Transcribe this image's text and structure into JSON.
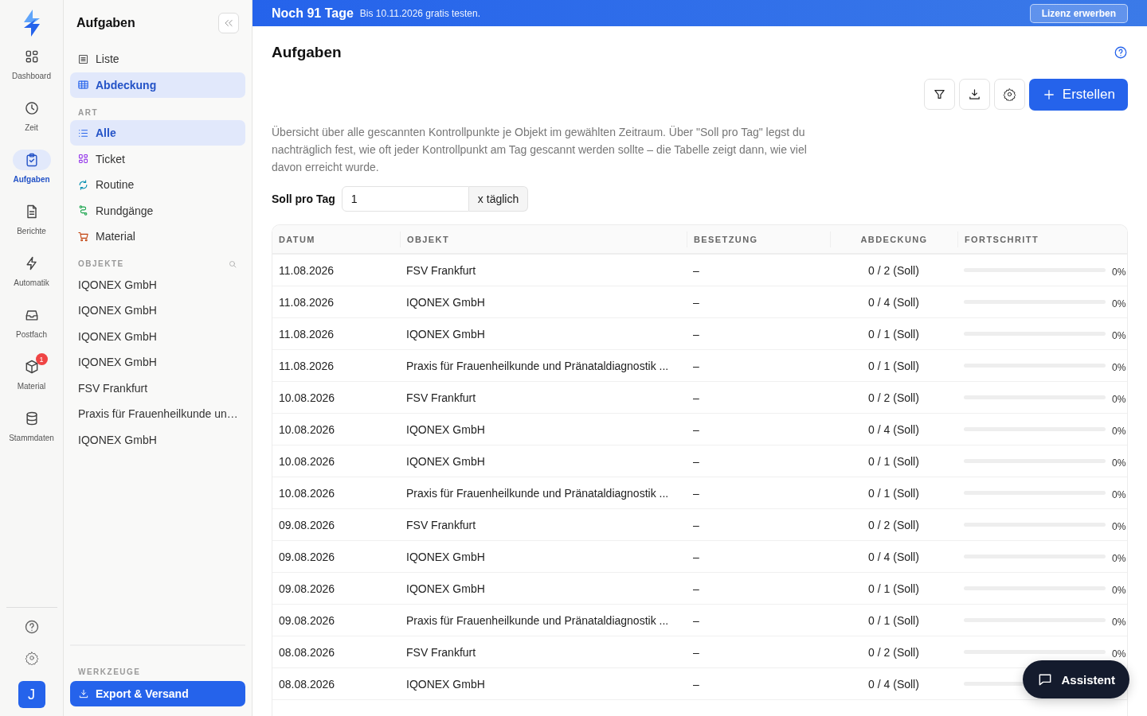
{
  "rail": {
    "items": [
      {
        "label": "Dashboard",
        "selected": false
      },
      {
        "label": "Zeit",
        "selected": false
      },
      {
        "label": "Aufgaben",
        "selected": true
      },
      {
        "label": "Berichte",
        "selected": false
      },
      {
        "label": "Automatik",
        "selected": false
      },
      {
        "label": "Postfach",
        "selected": false
      },
      {
        "label": "Material",
        "selected": false,
        "badge": "1"
      },
      {
        "label": "Stammdaten",
        "selected": false
      }
    ],
    "avatar": "J"
  },
  "sidebar": {
    "title": "Aufgaben",
    "views": [
      {
        "label": "Liste",
        "selected": false
      },
      {
        "label": "Abdeckung",
        "selected": true
      }
    ],
    "art": {
      "heading": "ART",
      "items": [
        {
          "label": "Alle",
          "selected": true
        },
        {
          "label": "Ticket",
          "selected": false
        },
        {
          "label": "Routine",
          "selected": false
        },
        {
          "label": "Rundgänge",
          "selected": false
        },
        {
          "label": "Material",
          "selected": false
        }
      ]
    },
    "objekte": {
      "heading": "OBJEKTE",
      "items": [
        "IQONEX GmbH",
        "IQONEX GmbH",
        "IQONEX GmbH",
        "IQONEX GmbH",
        "FSV Frankfurt",
        "Praxis für Frauenheilkunde un…",
        "IQONEX GmbH"
      ]
    },
    "werkzeuge": {
      "heading": "WERKZEUGE",
      "button": "Export & Versand"
    }
  },
  "banner": {
    "title": "Noch 91 Tage",
    "text": "Bis 10.11.2026 gratis testen.",
    "button": "Lizenz erwerben"
  },
  "page": {
    "title": "Aufgaben",
    "create_button": "Erstellen",
    "description": "Übersicht über alle gescannten Kontrollpunkte je Objekt im gewählten Zeitraum. Über \"Soll pro Tag\" legst du nachträglich fest, wie oft jeder Kontrollpunkt am Tag gescannt werden sollte – die Tabelle zeigt dann, wie viel davon erreicht wurde.",
    "soll": {
      "label": "Soll pro Tag",
      "value": "1",
      "suffix": "x täglich"
    }
  },
  "table": {
    "columns": [
      "DATUM",
      "OBJEKT",
      "BESETZUNG",
      "ABDECKUNG",
      "FORTSCHRITT"
    ],
    "rows": [
      {
        "datum": "11.08.2026",
        "objekt": "FSV Frankfurt",
        "besetzung": "–",
        "abdeckung": "0 / 2 (Soll)",
        "level": 0,
        "percent": "0%"
      },
      {
        "datum": "11.08.2026",
        "objekt": "IQONEX GmbH",
        "besetzung": "–",
        "abdeckung": "0 / 4 (Soll)",
        "level": 0,
        "percent": "0%"
      },
      {
        "datum": "11.08.2026",
        "objekt": "IQONEX GmbH",
        "besetzung": "–",
        "abdeckung": "0 / 1 (Soll)",
        "level": 0,
        "percent": "0%"
      },
      {
        "datum": "11.08.2026",
        "objekt": "Praxis für Frauenheilkunde und Pränataldiagnostik ...",
        "besetzung": "–",
        "abdeckung": "0 / 1 (Soll)",
        "level": 0,
        "percent": "0%"
      },
      {
        "datum": "10.08.2026",
        "objekt": "FSV Frankfurt",
        "besetzung": "–",
        "abdeckung": "0 / 2 (Soll)",
        "level": 0,
        "percent": "0%"
      },
      {
        "datum": "10.08.2026",
        "objekt": "IQONEX GmbH",
        "besetzung": "–",
        "abdeckung": "0 / 4 (Soll)",
        "level": 0,
        "percent": "0%"
      },
      {
        "datum": "10.08.2026",
        "objekt": "IQONEX GmbH",
        "besetzung": "–",
        "abdeckung": "0 / 1 (Soll)",
        "level": 0,
        "percent": "0%"
      },
      {
        "datum": "10.08.2026",
        "objekt": "Praxis für Frauenheilkunde und Pränataldiagnostik ...",
        "besetzung": "–",
        "abdeckung": "0 / 1 (Soll)",
        "level": 0,
        "percent": "0%"
      },
      {
        "datum": "09.08.2026",
        "objekt": "FSV Frankfurt",
        "besetzung": "–",
        "abdeckung": "0 / 2 (Soll)",
        "level": 0,
        "percent": "0%"
      },
      {
        "datum": "09.08.2026",
        "objekt": "IQONEX GmbH",
        "besetzung": "–",
        "abdeckung": "0 / 4 (Soll)",
        "level": 0,
        "percent": "0%"
      },
      {
        "datum": "09.08.2026",
        "objekt": "IQONEX GmbH",
        "besetzung": "–",
        "abdeckung": "0 / 1 (Soll)",
        "level": 0,
        "percent": "0%"
      },
      {
        "datum": "09.08.2026",
        "objekt": "Praxis für Frauenheilkunde und Pränataldiagnostik ...",
        "besetzung": "–",
        "abdeckung": "0 / 1 (Soll)",
        "level": 0,
        "percent": "0%"
      },
      {
        "datum": "08.08.2026",
        "objekt": "FSV Frankfurt",
        "besetzung": "–",
        "abdeckung": "0 / 2 (Soll)",
        "level": 0,
        "percent": "0%"
      },
      {
        "datum": "08.08.2026",
        "objekt": "IQONEX GmbH",
        "besetzung": "–",
        "abdeckung": "0 / 4 (Soll)",
        "level": 0
      }
    ]
  },
  "assistant": {
    "label": "Assistent"
  }
}
